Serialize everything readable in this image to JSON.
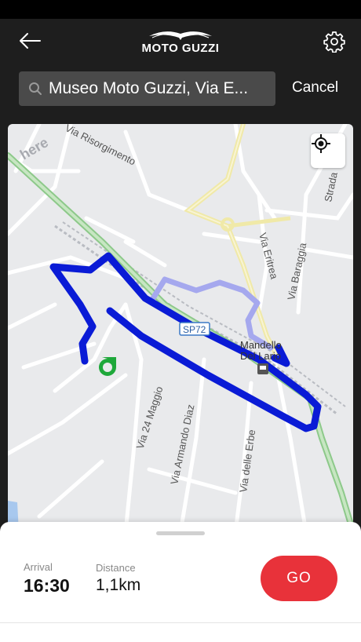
{
  "header": {
    "logo_text": "MOTO GUZZI",
    "back_icon": "arrow-left-icon",
    "settings_icon": "gear-icon"
  },
  "search": {
    "value": "Museo Moto Guzzi, Via E...",
    "cancel_label": "Cancel"
  },
  "map": {
    "provider_watermark": "here",
    "streets": [
      "Via Risorgimento",
      "Via Eritrea",
      "Via Baraggia",
      "Strada",
      "Via 24 Maggio",
      "Via Armando Diaz",
      "Via delle Erbe",
      "SP72"
    ],
    "town_label_1": "Mandello",
    "town_label_2": "Del Lario",
    "route_color": "#0a1bd6",
    "alt_route_color": "#a5a8ee",
    "start_marker_color": "#1ea83a"
  },
  "trip": {
    "arrival_label": "Arrival",
    "arrival_value": "16:30",
    "distance_label": "Distance",
    "distance_value": "1,1km",
    "go_label": "GO"
  },
  "colors": {
    "accent": "#e8323a",
    "header_bg": "#1e1e1e"
  }
}
